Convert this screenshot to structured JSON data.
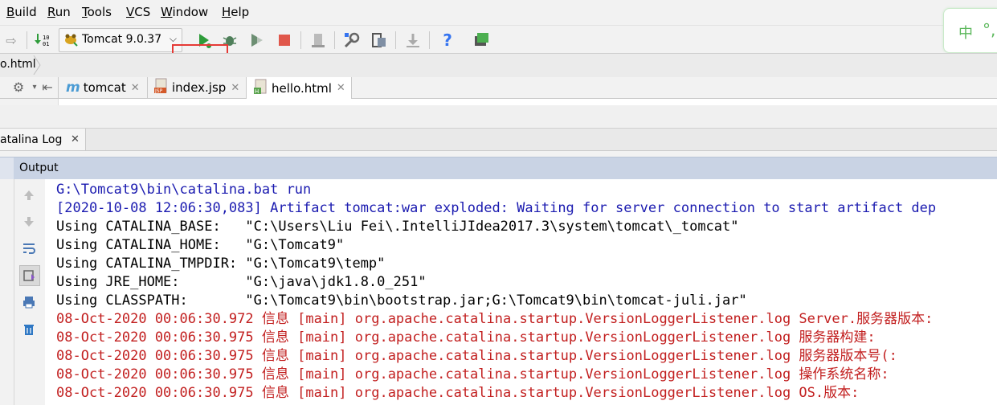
{
  "menu": [
    {
      "label": "Build",
      "underline": "B",
      "rest": "uild"
    },
    {
      "label": "Run",
      "underline": "R",
      "rest": "un"
    },
    {
      "label": "Tools",
      "underline": "T",
      "rest": "ools"
    },
    {
      "label": "VCS",
      "underline": "V",
      "rest": "CS"
    },
    {
      "label": "Window",
      "underline": "W",
      "rest": "indow"
    },
    {
      "label": "Help",
      "underline": "H",
      "rest": "elp"
    }
  ],
  "toolbar": {
    "run_config_label": "Tomcat 9.0.37",
    "colors": {
      "run": "#2e9c3a",
      "stop": "#e0574b",
      "highlight": "#e53935",
      "help": "#3574f0"
    }
  },
  "ime": {
    "char1": "中",
    "char2": "°,"
  },
  "breadcrumb": "o.html",
  "tabs": [
    {
      "label": "tomcat",
      "icon": "maven-m-icon"
    },
    {
      "label": "index.jsp",
      "icon": "jsp-file-icon"
    },
    {
      "label": "hello.html",
      "icon": "html-file-icon"
    }
  ],
  "log_tab": {
    "label": "atalina Log",
    "close": "✕"
  },
  "output": {
    "label": "Output"
  },
  "console": {
    "lines": [
      {
        "text": "G:\\Tomcat9\\bin\\catalina.bat run",
        "color": "blue"
      },
      {
        "text": "[2020-10-08 12:06:30,083] Artifact tomcat:war exploded: Waiting for server connection to start artifact dep",
        "color": "blue"
      },
      {
        "text": "Using CATALINA_BASE:   \"C:\\Users\\Liu Fei\\.IntelliJIdea2017.3\\system\\tomcat\\_tomcat\"",
        "color": "black"
      },
      {
        "text": "Using CATALINA_HOME:   \"G:\\Tomcat9\"",
        "color": "black"
      },
      {
        "text": "Using CATALINA_TMPDIR: \"G:\\Tomcat9\\temp\"",
        "color": "black"
      },
      {
        "text": "Using JRE_HOME:        \"G:\\java\\jdk1.8.0_251\"",
        "color": "black"
      },
      {
        "text": "Using CLASSPATH:       \"G:\\Tomcat9\\bin\\bootstrap.jar;G:\\Tomcat9\\bin\\tomcat-juli.jar\"",
        "color": "black"
      },
      {
        "text": "08-Oct-2020 00:06:30.972 信息 [main] org.apache.catalina.startup.VersionLoggerListener.log Server.服务器版本:",
        "color": "red"
      },
      {
        "text": "08-Oct-2020 00:06:30.975 信息 [main] org.apache.catalina.startup.VersionLoggerListener.log 服务器构建:",
        "color": "red"
      },
      {
        "text": "08-Oct-2020 00:06:30.975 信息 [main] org.apache.catalina.startup.VersionLoggerListener.log 服务器版本号(:",
        "color": "red"
      },
      {
        "text": "08-Oct-2020 00:06:30.975 信息 [main] org.apache.catalina.startup.VersionLoggerListener.log 操作系统名称:",
        "color": "red"
      },
      {
        "text": "08-Oct-2020 00:06:30.975 信息 [main] org.apache.catalina.startup.VersionLoggerListener.log OS.版本:",
        "color": "red"
      }
    ]
  }
}
